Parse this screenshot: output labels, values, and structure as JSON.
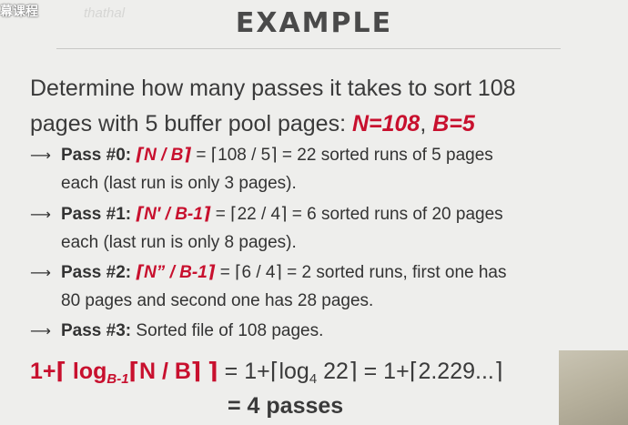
{
  "watermark": "幕课程",
  "watermark_faint": "thathal",
  "title": "EXAMPLE",
  "intro": {
    "line1": "Determine how many passes it takes to sort 108",
    "line2_text": "pages with 5 buffer pool pages: ",
    "n_var": "N=108",
    "comma": ", ",
    "b_var": "B=5"
  },
  "steps": [
    {
      "arrow": "⟶",
      "label": "Pass #0:",
      "formula": "⌈N / B⌉",
      "text": " = ⌈108 / 5⌉ = 22 sorted runs of 5 pages",
      "cont": "each (last run is only 3 pages)."
    },
    {
      "arrow": "⟶",
      "label": "Pass #1:",
      "formula": "⌈N′ / B-1⌉",
      "text": " = ⌈22 / 4⌉ = 6 sorted runs of 20 pages",
      "cont": "each (last run is only 8 pages)."
    },
    {
      "arrow": "⟶",
      "label": "Pass #2:",
      "formula": "⌈N” / B-1⌉",
      "text": " = ⌈6 / 4⌉ = 2 sorted runs, first one has",
      "cont": "80 pages and second one has 28 pages."
    },
    {
      "arrow": "⟶",
      "label": "Pass #3:",
      "text": " Sorted file of 108 pages."
    }
  ],
  "formula": {
    "red_prefix": "1+⌈ log",
    "red_sub": "B-1",
    "red_mid": "⌈N / B⌉ ⌉",
    "rest1": " = 1+⌈log",
    "rest_sub": "4",
    "rest2": " 22⌉ = 1+⌈2.229...⌉"
  },
  "result": "= 4 passes",
  "colors": {
    "accent": "#c8102e",
    "text": "#3a3a3a",
    "background": "#eeeeec"
  }
}
